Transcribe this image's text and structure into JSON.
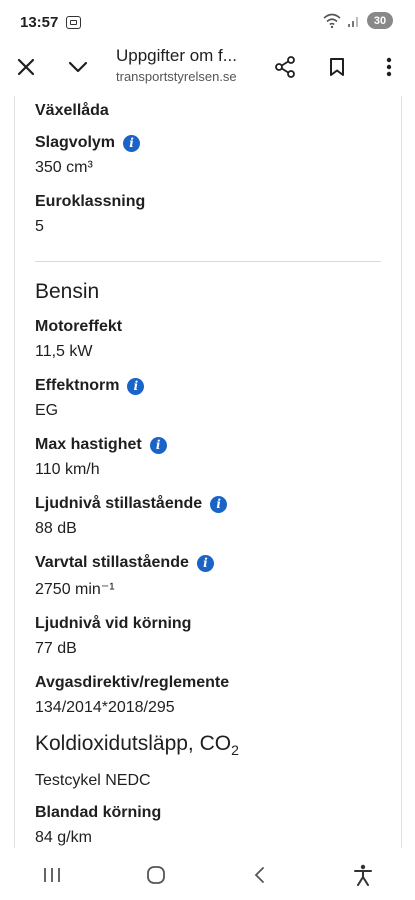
{
  "status": {
    "time": "13:57",
    "battery": "30"
  },
  "browser": {
    "page_title": "Uppgifter om f...",
    "host": "transportstyrelsen.se"
  },
  "fields_top": [
    {
      "label": "Växellåda",
      "value": "",
      "info": false
    },
    {
      "label": "Slagvolym",
      "value": "350 cm³",
      "info": true
    },
    {
      "label": "Euroklassning",
      "value": "5",
      "info": false
    }
  ],
  "bensin": {
    "heading": "Bensin",
    "fields": [
      {
        "label": "Motoreffekt",
        "value": "11,5 kW",
        "info": false
      },
      {
        "label": "Effektnorm",
        "value": "EG",
        "info": true
      },
      {
        "label": "Max hastighet",
        "value": "110 km/h",
        "info": true
      },
      {
        "label": "Ljudnivå stillastående",
        "value": "88 dB",
        "info": true
      },
      {
        "label": "Varvtal stillastående",
        "value": "2750 min⁻¹",
        "info": true
      },
      {
        "label": "Ljudnivå vid körning",
        "value": "77 dB",
        "info": false
      },
      {
        "label": "Avgasdirektiv/reglemente",
        "value": "134/2014*2018/295",
        "info": false
      }
    ]
  },
  "co2": {
    "heading": "Koldioxidutsläpp, CO",
    "heading_sub": "2",
    "subheading": "Testcykel NEDC",
    "fields": [
      {
        "label": "Blandad körning",
        "value": "84 g/km",
        "info": false
      }
    ]
  },
  "icons": {
    "close": "close-icon",
    "expand": "chevron-down-icon",
    "share": "share-icon",
    "bookmark": "bookmark-icon",
    "menu": "more-vert-icon",
    "info": "info-icon"
  },
  "info_glyph": "i",
  "colors": {
    "info": "#1a64c8",
    "text": "#1f1f1f"
  }
}
